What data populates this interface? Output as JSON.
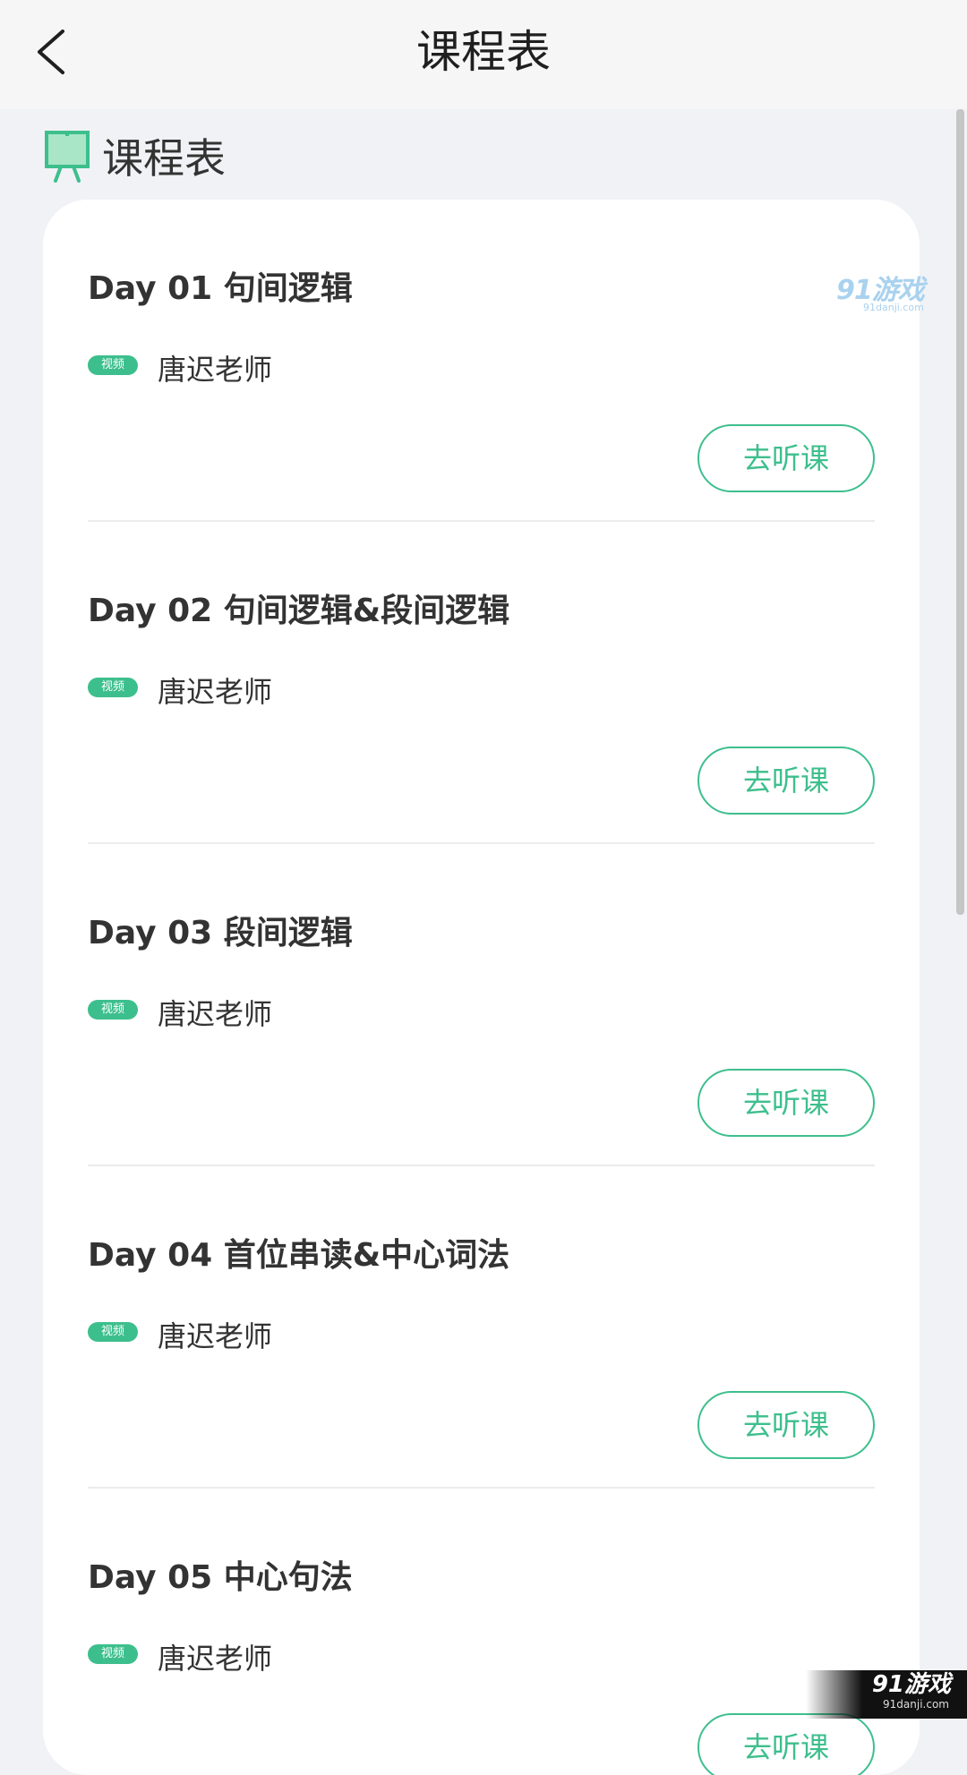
{
  "navbar": {
    "title": "课程表"
  },
  "section": {
    "title": "课程表"
  },
  "watermark": {
    "main": "91游戏",
    "sub": "91danji.com"
  },
  "lessons": [
    {
      "title": "Day 01 句间逻辑",
      "tag": "视频",
      "teacher": "唐迟老师",
      "button": "去听课"
    },
    {
      "title": "Day 02 句间逻辑&段间逻辑",
      "tag": "视频",
      "teacher": "唐迟老师",
      "button": "去听课"
    },
    {
      "title": "Day 03 段间逻辑",
      "tag": "视频",
      "teacher": "唐迟老师",
      "button": "去听课"
    },
    {
      "title": "Day 04 首位串读&中心词法",
      "tag": "视频",
      "teacher": "唐迟老师",
      "button": "去听课"
    },
    {
      "title": "Day 05 中心句法",
      "tag": "视频",
      "teacher": "唐迟老师",
      "button": "去听课"
    }
  ],
  "corner_logo": {
    "main": "91游戏",
    "sub": "91danji.com"
  },
  "colors": {
    "accent": "#3dbf8d",
    "page_bg": "#f1f2f5",
    "card_bg": "#ffffff"
  },
  "icons": {
    "back": "chevron-left-icon",
    "section": "presentation-board-icon"
  }
}
